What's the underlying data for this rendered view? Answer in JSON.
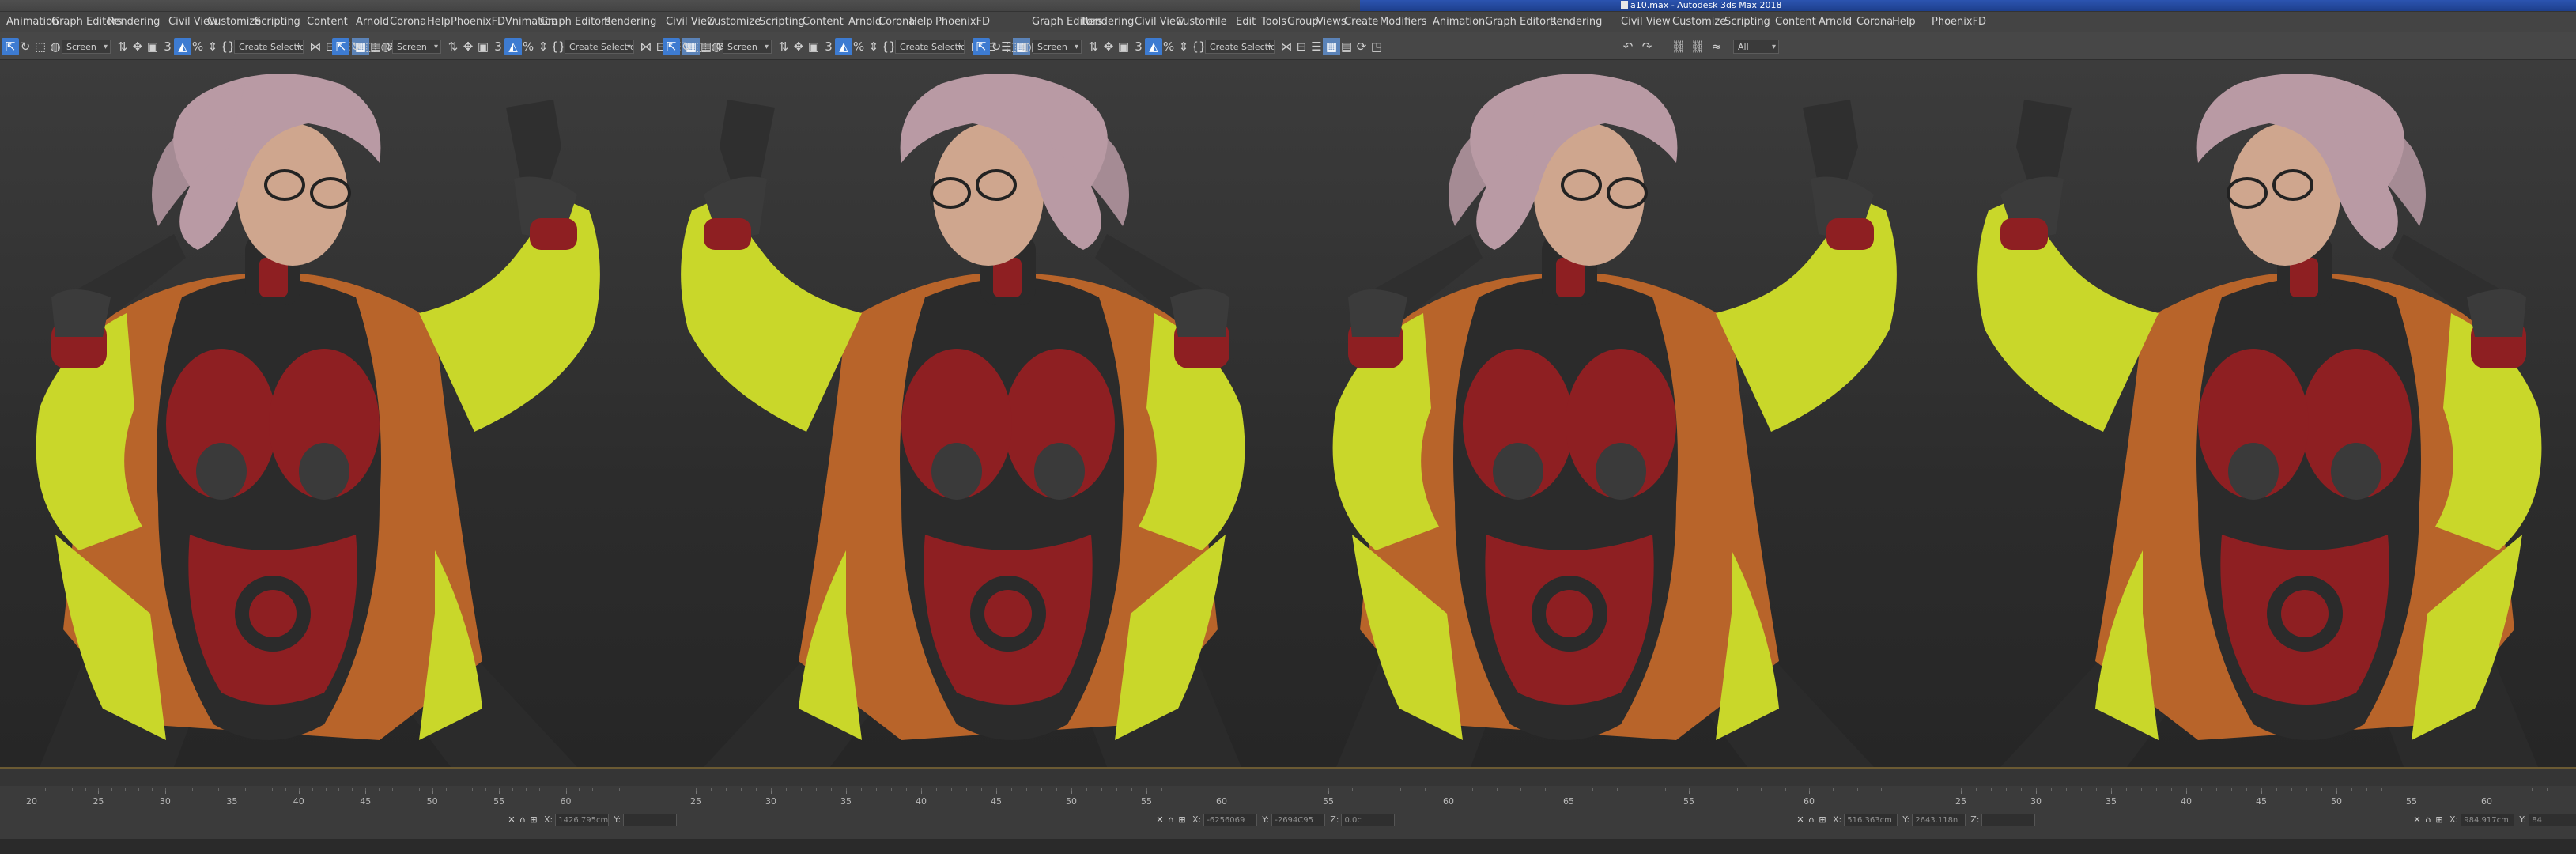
{
  "window": {
    "title": "a10.max - Autodesk 3ds Max 2018"
  },
  "menus": [
    {
      "label": "Animation"
    },
    {
      "label": "Graph Editors"
    },
    {
      "label": "Rendering"
    },
    {
      "label": "Civil View"
    },
    {
      "label": "Customize"
    },
    {
      "label": "Scripting"
    },
    {
      "label": "Content"
    },
    {
      "label": "Arnold"
    },
    {
      "label": "Corona"
    },
    {
      "label": "Help"
    },
    {
      "label": "PhoenixFDVnimation"
    },
    {
      "label": "Graph Editors"
    },
    {
      "label": "Rendering"
    },
    {
      "label": "Civil View"
    },
    {
      "label": "Customize"
    },
    {
      "label": "Scripting"
    },
    {
      "label": "Content"
    },
    {
      "label": "Arnold"
    },
    {
      "label": "Corona"
    },
    {
      "label": "Help"
    },
    {
      "label": "PhoenixFD"
    },
    {
      "label": "Graph Editors"
    },
    {
      "label": "Rendering"
    },
    {
      "label": "Civil View"
    },
    {
      "label": "Custom"
    },
    {
      "label": "File"
    },
    {
      "label": "Edit"
    },
    {
      "label": "Tools"
    },
    {
      "label": "Group"
    },
    {
      "label": "Views"
    },
    {
      "label": "Create"
    },
    {
      "label": "Modifiers"
    },
    {
      "label": "Animation"
    },
    {
      "label": "Graph Editors"
    },
    {
      "label": "Rendering"
    },
    {
      "label": "Civil View"
    },
    {
      "label": "Customize"
    },
    {
      "label": "Scripting"
    },
    {
      "label": "Content"
    },
    {
      "label": "Arnold"
    },
    {
      "label": "Corona"
    },
    {
      "label": "Help"
    },
    {
      "label": "PhoenixFD"
    }
  ],
  "toolbar": {
    "ref_coord_value": "Screen",
    "selection_set_placeholder": "Create Selection Se",
    "filter_value": "All"
  },
  "timeline": {
    "ruler_segments": [
      {
        "ticks": [
          "20",
          "25",
          "30",
          "35",
          "40",
          "45",
          "50",
          "55",
          "60"
        ]
      },
      {
        "ticks": [
          "25",
          "30",
          "35",
          "40",
          "45",
          "50",
          "55",
          "60"
        ]
      },
      {
        "ticks": [
          "55",
          "60",
          "65",
          "55",
          "60"
        ]
      },
      {
        "ticks": [
          "25",
          "30",
          "35",
          "40",
          "45",
          "50",
          "55",
          "60"
        ]
      }
    ]
  },
  "status": {
    "groups": [
      {
        "x_label": "X:",
        "x_value": "1426.795cm",
        "y_label": "Y:",
        "y_value": ""
      },
      {
        "x_label": "X:",
        "x_value": "-6256069",
        "y_label": "Y:",
        "y_value": "-2694C95",
        "z_label": "Z:",
        "z_value": "0.0c"
      },
      {
        "x_label": "X:",
        "x_value": "516.363cm",
        "y_label": "Y:",
        "y_value": "2643.118n",
        "z_label": "Z:",
        "z_value": ""
      },
      {
        "x_label": "X:",
        "x_value": "984.917cm",
        "y_label": "Y:",
        "y_value": "84"
      }
    ]
  },
  "colors": {
    "title_active": "#2c54b0",
    "menu_bg": "#444444",
    "toolbar_highlight": "#3d7bd1",
    "viewport_top": "#3c3c3c",
    "viewport_bottom": "#262626",
    "jacket": "#c9d72a",
    "jacket_orange": "#b8642a",
    "suit_red": "#8e1f22",
    "suit_black": "#2b2b2b",
    "hair": "#b99aa4",
    "skin": "#cfa68e"
  },
  "viewport_figures": [
    {
      "name": "character-view-1"
    },
    {
      "name": "character-view-2"
    },
    {
      "name": "character-view-3"
    },
    {
      "name": "character-view-4"
    }
  ]
}
